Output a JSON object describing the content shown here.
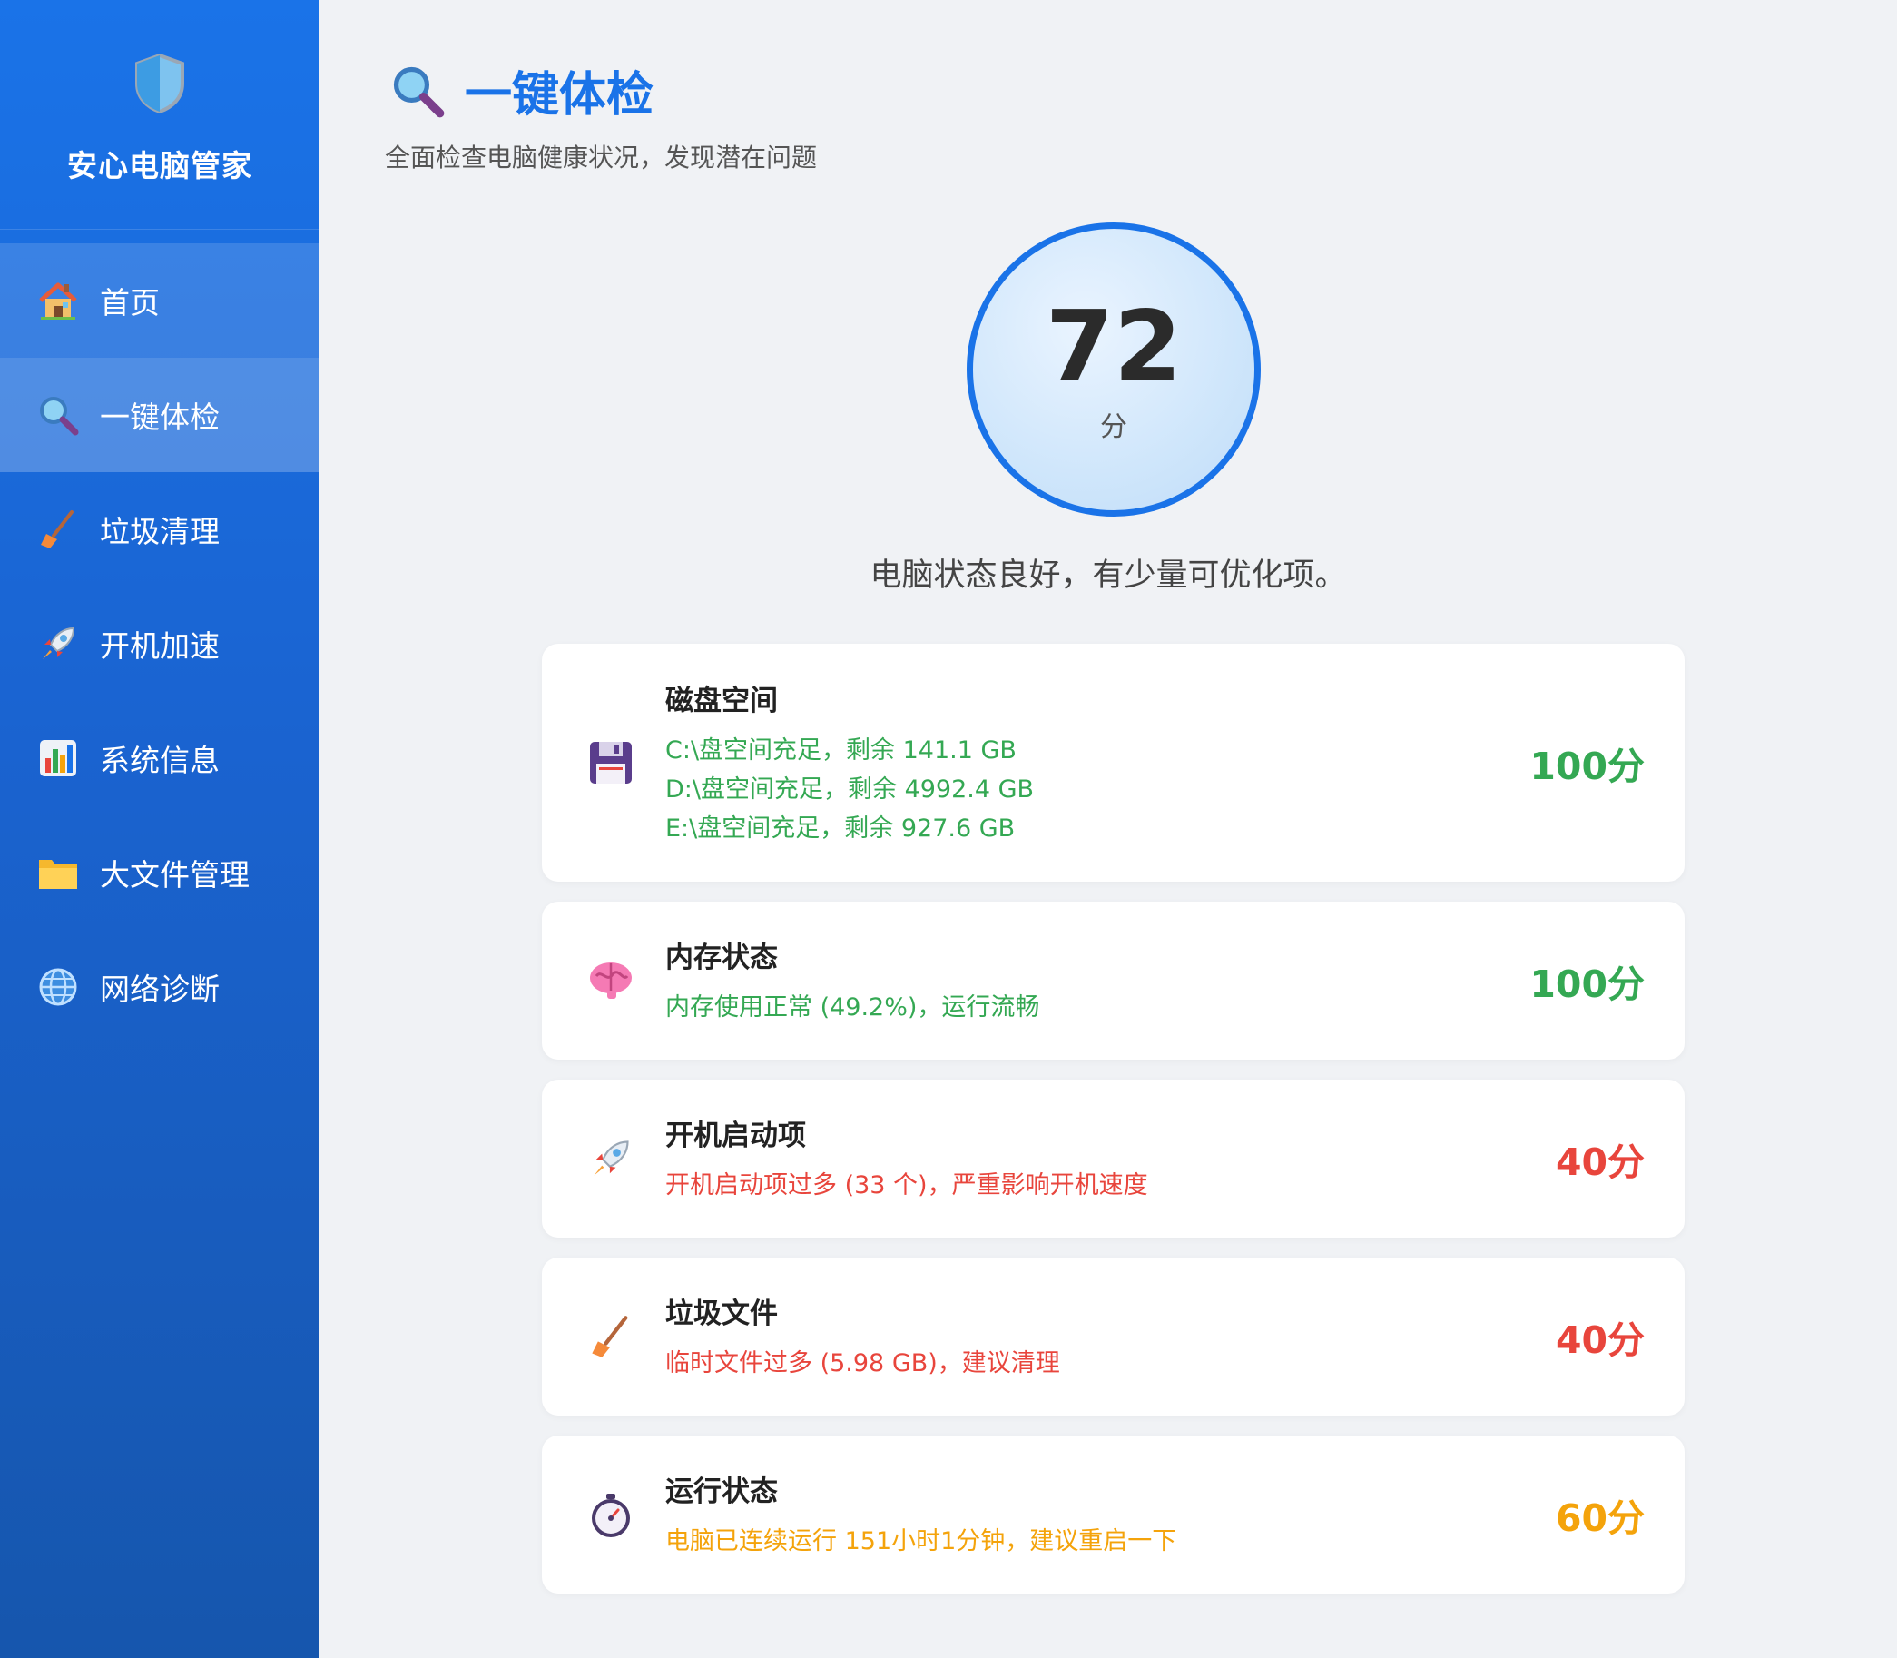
{
  "app": {
    "name": "安心电脑管家"
  },
  "sidebar": {
    "items": [
      {
        "label": "首页",
        "icon": "house-icon"
      },
      {
        "label": "一键体检",
        "icon": "magnifier-icon"
      },
      {
        "label": "垃圾清理",
        "icon": "broom-icon"
      },
      {
        "label": "开机加速",
        "icon": "rocket-icon"
      },
      {
        "label": "系统信息",
        "icon": "bar-chart-icon"
      },
      {
        "label": "大文件管理",
        "icon": "folder-icon"
      },
      {
        "label": "网络诊断",
        "icon": "globe-icon"
      }
    ],
    "active_index": 1
  },
  "page": {
    "title": "一键体检",
    "subtitle": "全面检查电脑健康状况，发现潜在问题"
  },
  "score": {
    "value": "72",
    "unit": "分",
    "summary": "电脑状态良好，有少量可优化项。"
  },
  "checks": [
    {
      "title": "磁盘空间",
      "icon": "floppy-disk-icon",
      "details": [
        "C:\\盘空间充足，剩余 141.1 GB",
        "D:\\盘空间充足，剩余 4992.4 GB",
        "E:\\盘空间充足，剩余 927.6 GB"
      ],
      "score": "100分",
      "status": "good"
    },
    {
      "title": "内存状态",
      "icon": "brain-icon",
      "details": [
        "内存使用正常 (49.2%)，运行流畅"
      ],
      "score": "100分",
      "status": "good"
    },
    {
      "title": "开机启动项",
      "icon": "rocket-icon",
      "details": [
        "开机启动项过多 (33 个)，严重影响开机速度"
      ],
      "score": "40分",
      "status": "bad"
    },
    {
      "title": "垃圾文件",
      "icon": "broom-icon",
      "details": [
        "临时文件过多 (5.98 GB)，建议清理"
      ],
      "score": "40分",
      "status": "bad"
    },
    {
      "title": "运行状态",
      "icon": "stopwatch-icon",
      "details": [
        "电脑已连续运行 151小时1分钟，建议重启一下"
      ],
      "score": "60分",
      "status": "warn"
    }
  ],
  "colors": {
    "accent": "#1a73e8",
    "good": "#34a853",
    "bad": "#e8453c",
    "warn": "#f4a30b"
  }
}
